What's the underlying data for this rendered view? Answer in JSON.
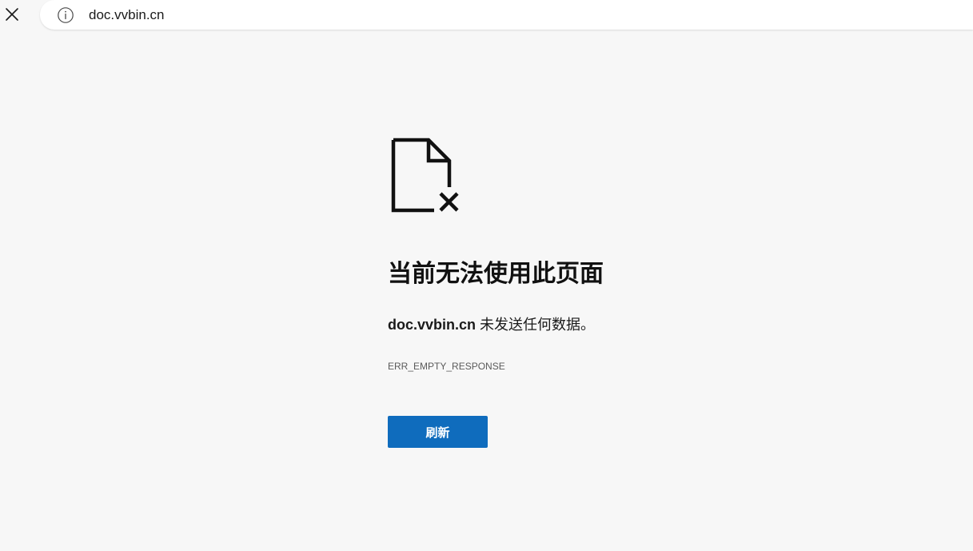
{
  "browser": {
    "url": "doc.vvbin.cn"
  },
  "error": {
    "title": "当前无法使用此页面",
    "host": "doc.vvbin.cn",
    "message": " 未发送任何数据。",
    "code": "ERR_EMPTY_RESPONSE",
    "reload_label": "刷新"
  },
  "icons": {
    "close": "close-icon",
    "info": "info-icon",
    "document_error": "document-error-icon"
  },
  "colors": {
    "page_background": "#f7f7f7",
    "button_background": "#0f6cbd",
    "button_text": "#ffffff"
  }
}
